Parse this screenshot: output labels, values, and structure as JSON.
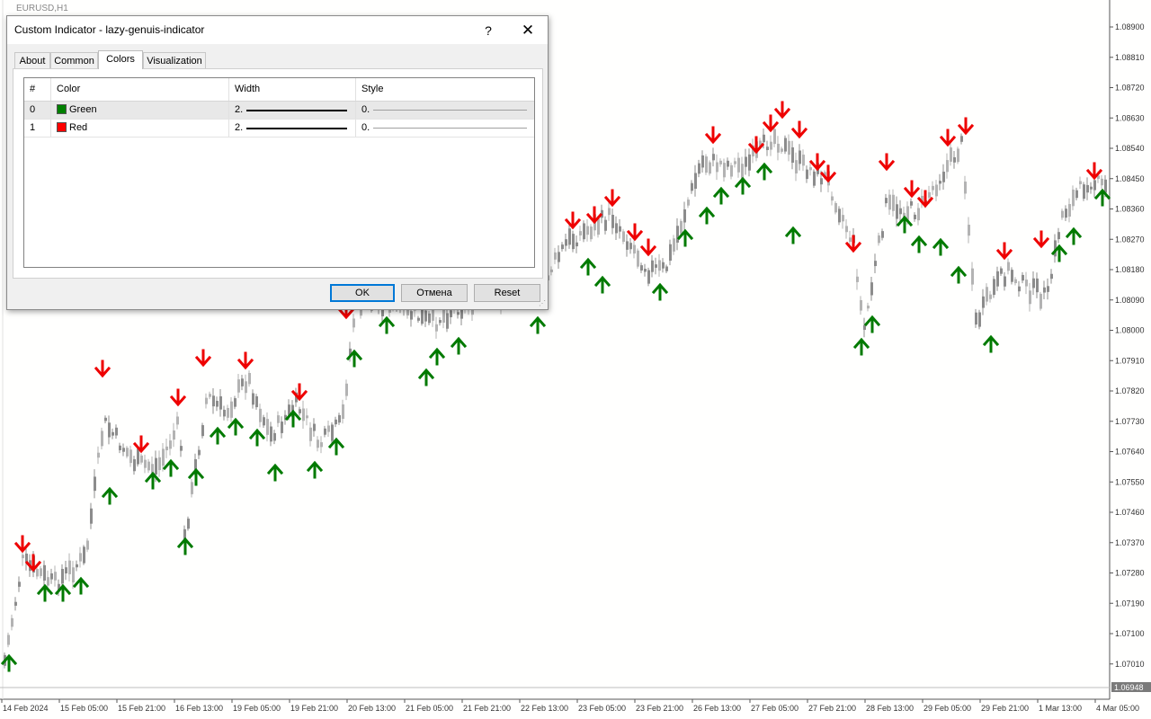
{
  "chart": {
    "symbol_label": "EURUSD,H1",
    "price_ticks": [
      "1.08900",
      "1.08810",
      "1.08720",
      "1.08630",
      "1.08540",
      "1.08450",
      "1.08360",
      "1.08270",
      "1.08180",
      "1.08090",
      "1.08000",
      "1.07910",
      "1.07820",
      "1.07730",
      "1.07640",
      "1.07550",
      "1.07460",
      "1.07370",
      "1.07280",
      "1.07190",
      "1.07100",
      "1.07010"
    ],
    "current_price": "1.06948",
    "time_labels": [
      "14 Feb 2024",
      "15 Feb 05:00",
      "15 Feb 21:00",
      "16 Feb 13:00",
      "19 Feb 05:00",
      "19 Feb 21:00",
      "20 Feb 13:00",
      "21 Feb 05:00",
      "21 Feb 21:00",
      "22 Feb 13:00",
      "23 Feb 05:00",
      "23 Feb 21:00",
      "26 Feb 13:00",
      "27 Feb 05:00",
      "27 Feb 21:00",
      "28 Feb 13:00",
      "29 Feb 05:00",
      "29 Feb 21:00",
      "1 Mar 13:00",
      "4 Mar 05:00"
    ],
    "colors": {
      "up_arrow": "#007a00",
      "down_arrow": "#ee0000",
      "candle": "#b3b3b3",
      "candle_dark": "#8c8c8c",
      "axis": "#555555"
    }
  },
  "dialog": {
    "title": "Custom Indicator - lazy-genuis-indicator",
    "help_label": "?",
    "close_label": "✕",
    "tabs": [
      {
        "label": "About"
      },
      {
        "label": "Common"
      },
      {
        "label": "Colors",
        "active": true
      },
      {
        "label": "Visualization"
      }
    ],
    "table": {
      "headers": [
        "#",
        "Color",
        "Width",
        "Style"
      ],
      "rows": [
        {
          "index": "0",
          "color_name": "Green",
          "color_hex": "#008000",
          "width": "2.",
          "style": "0."
        },
        {
          "index": "1",
          "color_name": "Red",
          "color_hex": "#ff0000",
          "width": "2.",
          "style": "0."
        }
      ]
    },
    "buttons": {
      "ok": "OK",
      "cancel": "Отмена",
      "reset": "Reset"
    }
  }
}
